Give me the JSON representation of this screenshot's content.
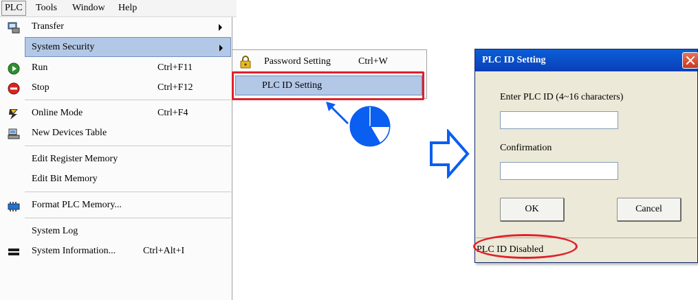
{
  "menubar": {
    "items": [
      {
        "label": "PLC"
      },
      {
        "label": "Tools"
      },
      {
        "label": "Window"
      },
      {
        "label": "Help"
      }
    ]
  },
  "plc_menu": {
    "transfer": "Transfer",
    "system_security": "System Security",
    "run": {
      "label": "Run",
      "shortcut": "Ctrl+F11"
    },
    "stop": {
      "label": "Stop",
      "shortcut": "Ctrl+F12"
    },
    "online_mode": {
      "label": "Online Mode",
      "shortcut": "Ctrl+F4"
    },
    "new_devices_table": "New Devices Table",
    "edit_register_memory": "Edit Register Memory",
    "edit_bit_memory": "Edit Bit Memory",
    "format_plc_memory": "Format PLC Memory...",
    "system_log": "System Log",
    "system_information": {
      "label": "System Information...",
      "shortcut": "Ctrl+Alt+I"
    }
  },
  "submenu": {
    "password_setting": {
      "label": "Password Setting",
      "shortcut": "Ctrl+W"
    },
    "plc_id_setting": "PLC ID Setting"
  },
  "dialog": {
    "title": "PLC ID Setting",
    "enter_label": "Enter PLC ID (4~16 characters)",
    "enter_value": "",
    "confirm_label": "Confirmation",
    "confirm_value": "",
    "ok_label": "OK",
    "cancel_label": "Cancel",
    "status": "PLC ID Disabled"
  },
  "colors": {
    "highlight": "#b3c8e6",
    "annotation_red": "#e0202a",
    "arrow_blue": "#0a5ef0",
    "titlebar_blue": "#0a46c8"
  }
}
